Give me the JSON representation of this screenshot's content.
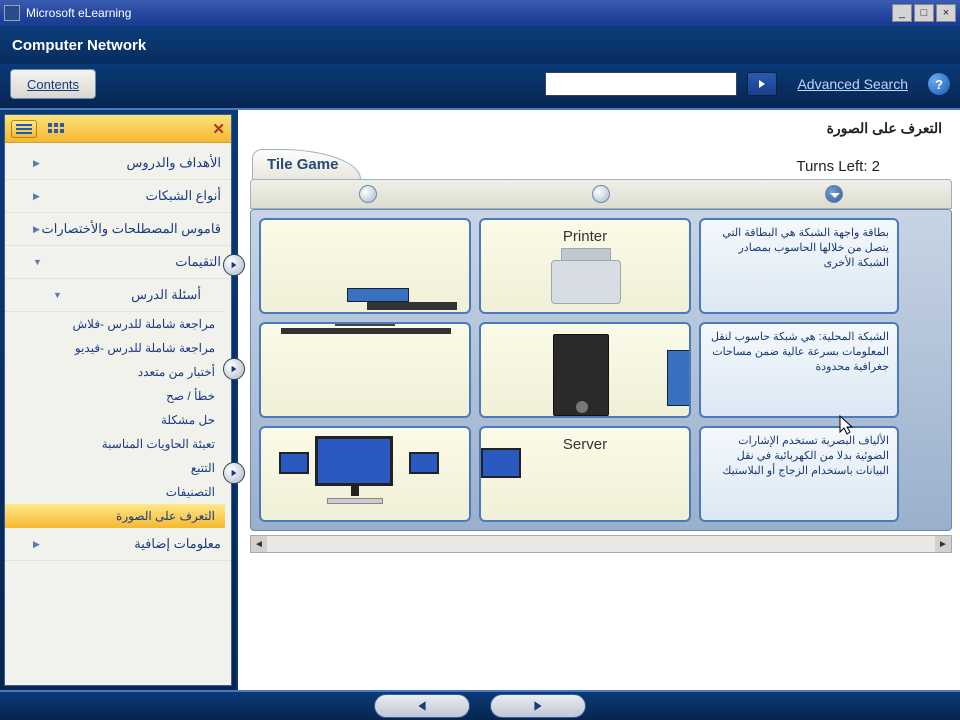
{
  "window": {
    "title": "Microsoft eLearning"
  },
  "subtitle": "Computer Network",
  "toolbar": {
    "contents": "Contents",
    "advanced_search": "Advanced Search",
    "help": "?"
  },
  "sidebar": {
    "top_items": [
      "الأهداف والدروس",
      "أنواع الشبكات",
      "قاموس المصطلحات والأختصارات"
    ],
    "expanded": "التقيمات",
    "sub_header": "أسئلة الدرس",
    "leaves": [
      "مراجعة شاملة للدرس -فلاش",
      "مراجعة شاملة للدرس -فيديو",
      "أختبار من متعدد",
      "خطأ / صح",
      "حل مشكلة",
      "تعبئة الحاويات المناسبة",
      "التتبع",
      "التصنيفات",
      "التعرف على الصورة"
    ],
    "selected_index": 8,
    "extra": "معلومات إضافية"
  },
  "content": {
    "heading": "التعرف على الصورة",
    "game_tab": "Tile Game",
    "turns_label": "Turns Left:",
    "turns_value": "2",
    "tiles": {
      "r1c2_label": "Printer",
      "r3c2_label": "Server",
      "r1c3_text": "بطاقة واجهة الشبكة هي البطاقة التي يتصل من خلالها الحاسوب بمصادر الشبكة الأخرى",
      "r2c3_text": "الشبكة المحلية: هي شبكة حاسوب لنقل المعلومات بسرعة عالية ضمن مساحات جغرافية محدودة",
      "r3c3_text": "الألياف البصرية تستخدم الإشارات الضوئية بدلا من الكهربائية في نقل البيانات باستخدام الزجاج أو البلاستيك"
    }
  }
}
